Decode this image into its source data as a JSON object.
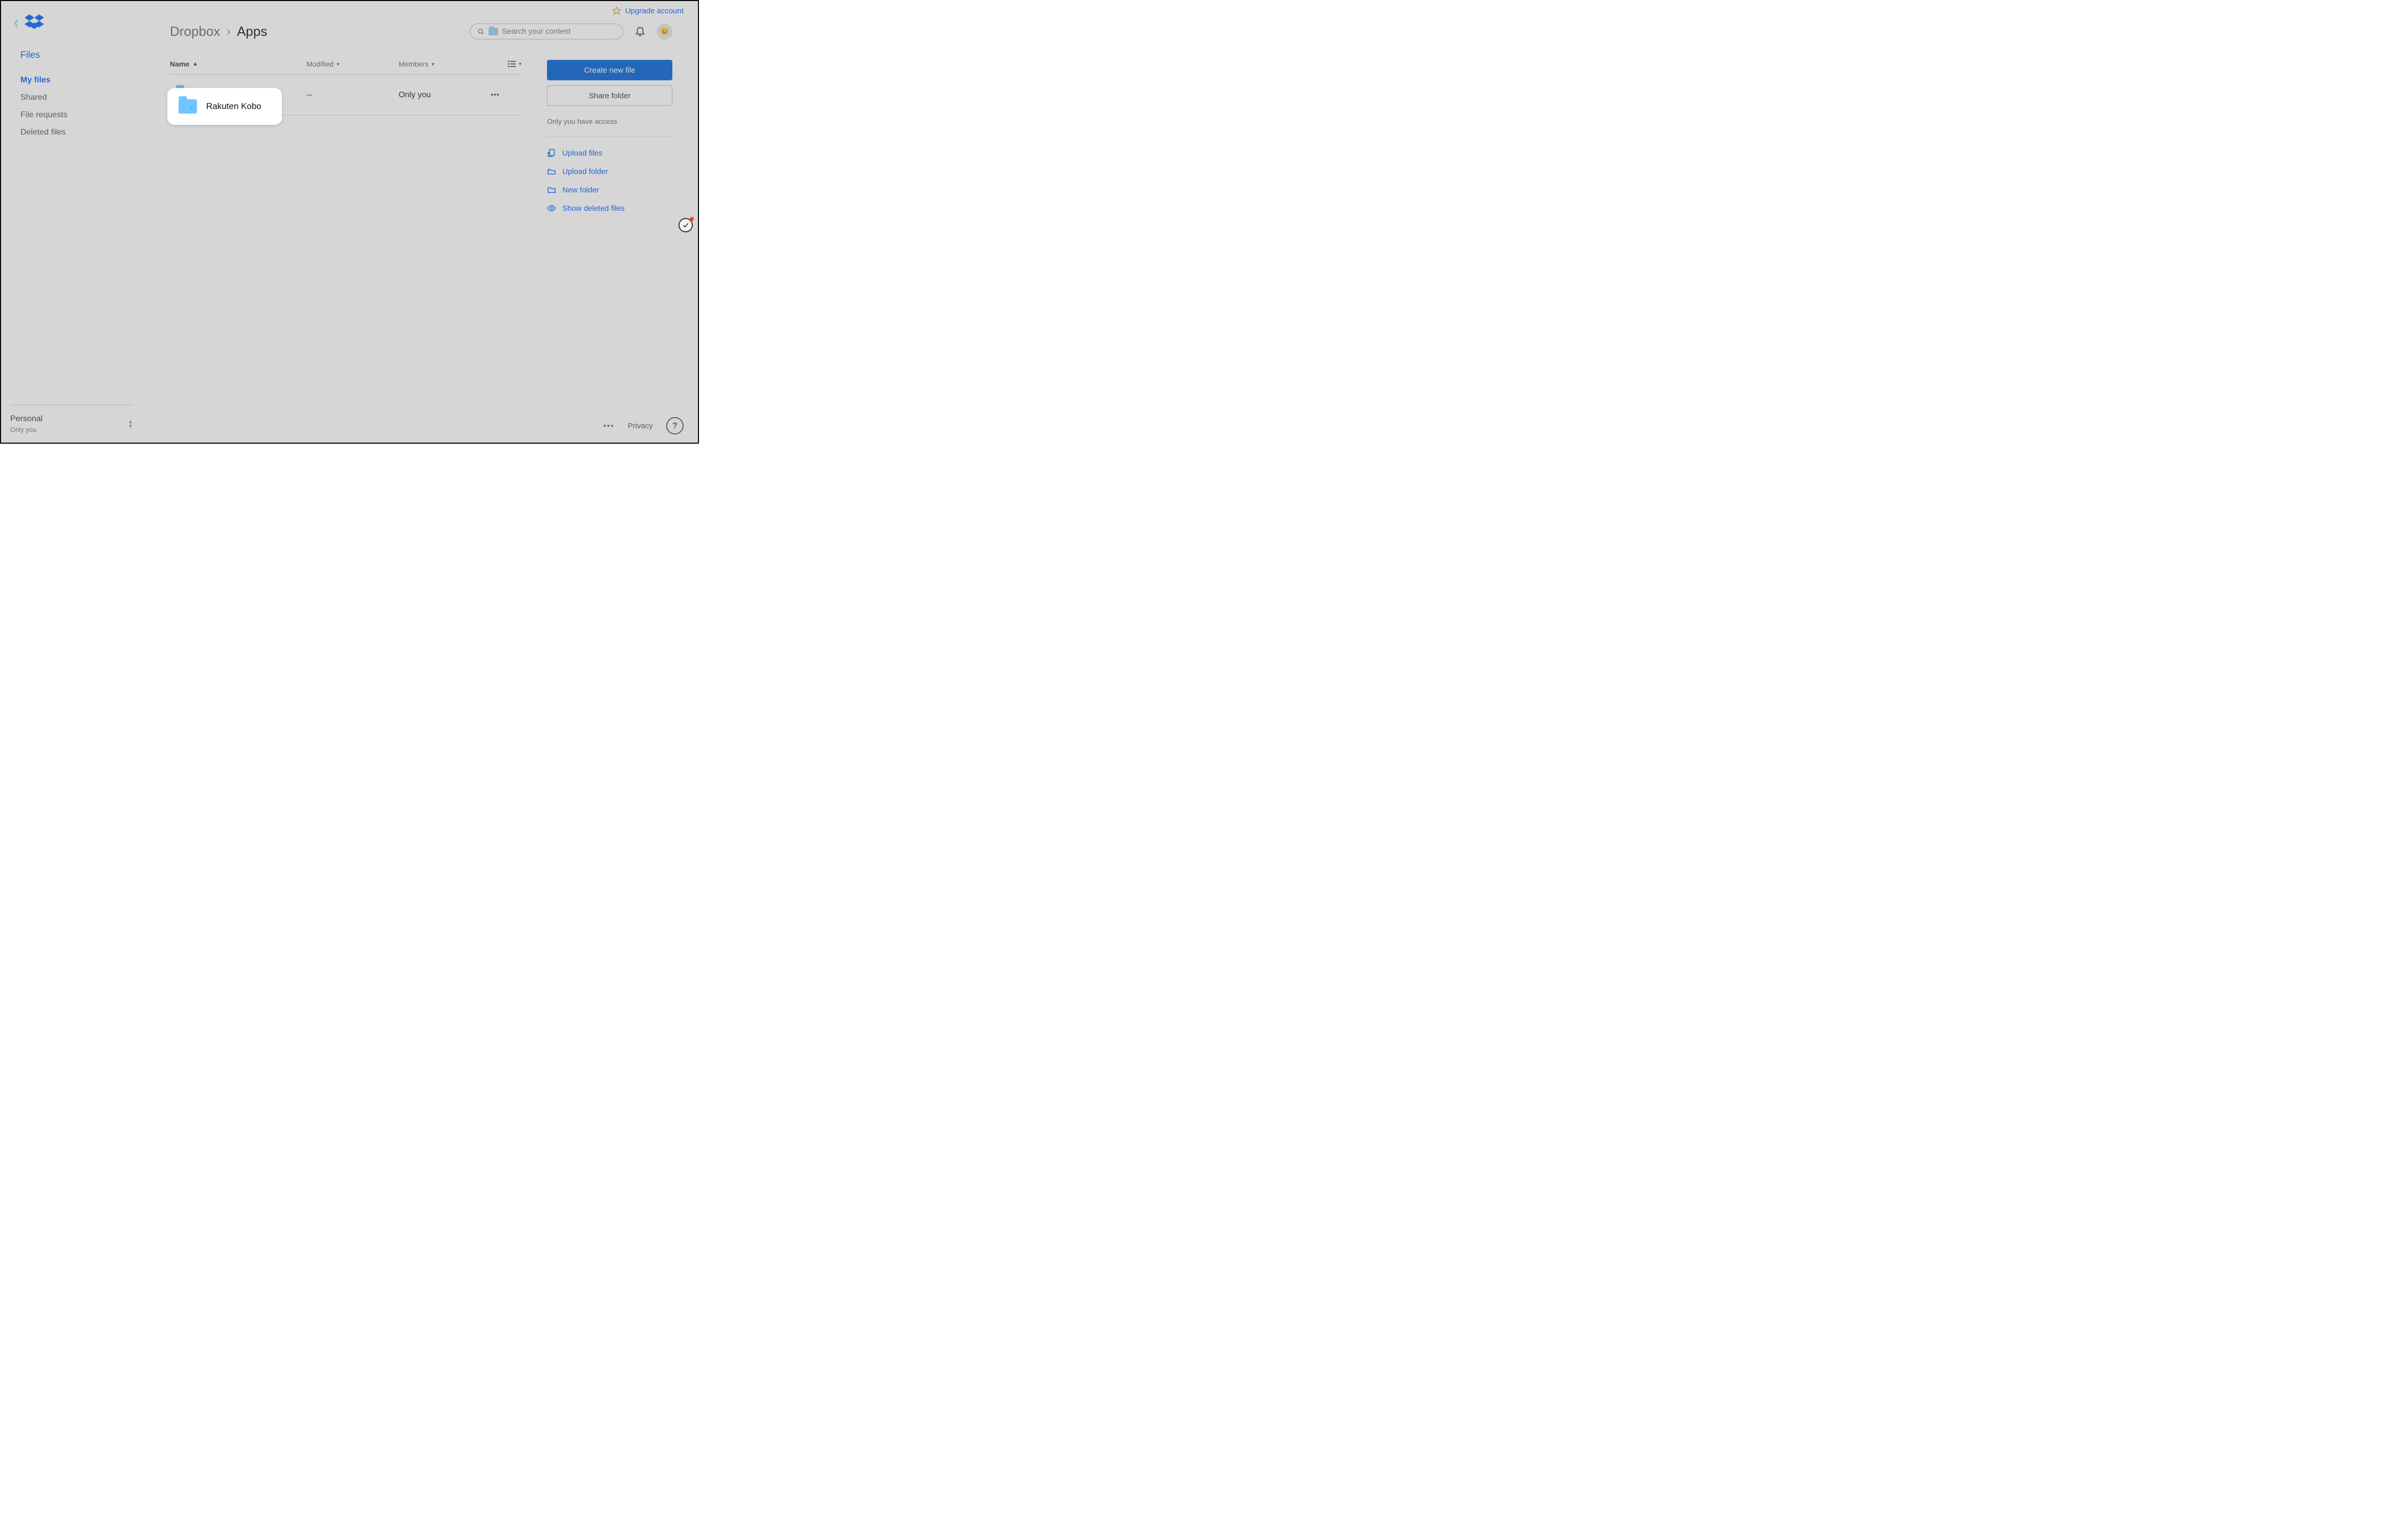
{
  "upgrade": {
    "label": "Upgrade account"
  },
  "sidebar": {
    "section": "Files",
    "items": [
      {
        "label": "My files",
        "active": true
      },
      {
        "label": "Shared"
      },
      {
        "label": "File requests"
      },
      {
        "label": "Deleted files"
      }
    ],
    "account": {
      "name": "Personal",
      "sub": "Only you"
    }
  },
  "breadcrumb": {
    "root": "Dropbox",
    "current": "Apps"
  },
  "search": {
    "placeholder": "Search your content"
  },
  "columns": {
    "name": "Name",
    "modified": "Modified",
    "members": "Members"
  },
  "rows": [
    {
      "name": "Rakuten Kobo",
      "modified": "--",
      "members": "Only you"
    }
  ],
  "right": {
    "create": "Create new file",
    "share": "Share folder",
    "access": "Only you have access",
    "actions": [
      {
        "label": "Upload files"
      },
      {
        "label": "Upload folder"
      },
      {
        "label": "New folder"
      },
      {
        "label": "Show deleted files"
      }
    ]
  },
  "footer": {
    "privacy": "Privacy"
  }
}
